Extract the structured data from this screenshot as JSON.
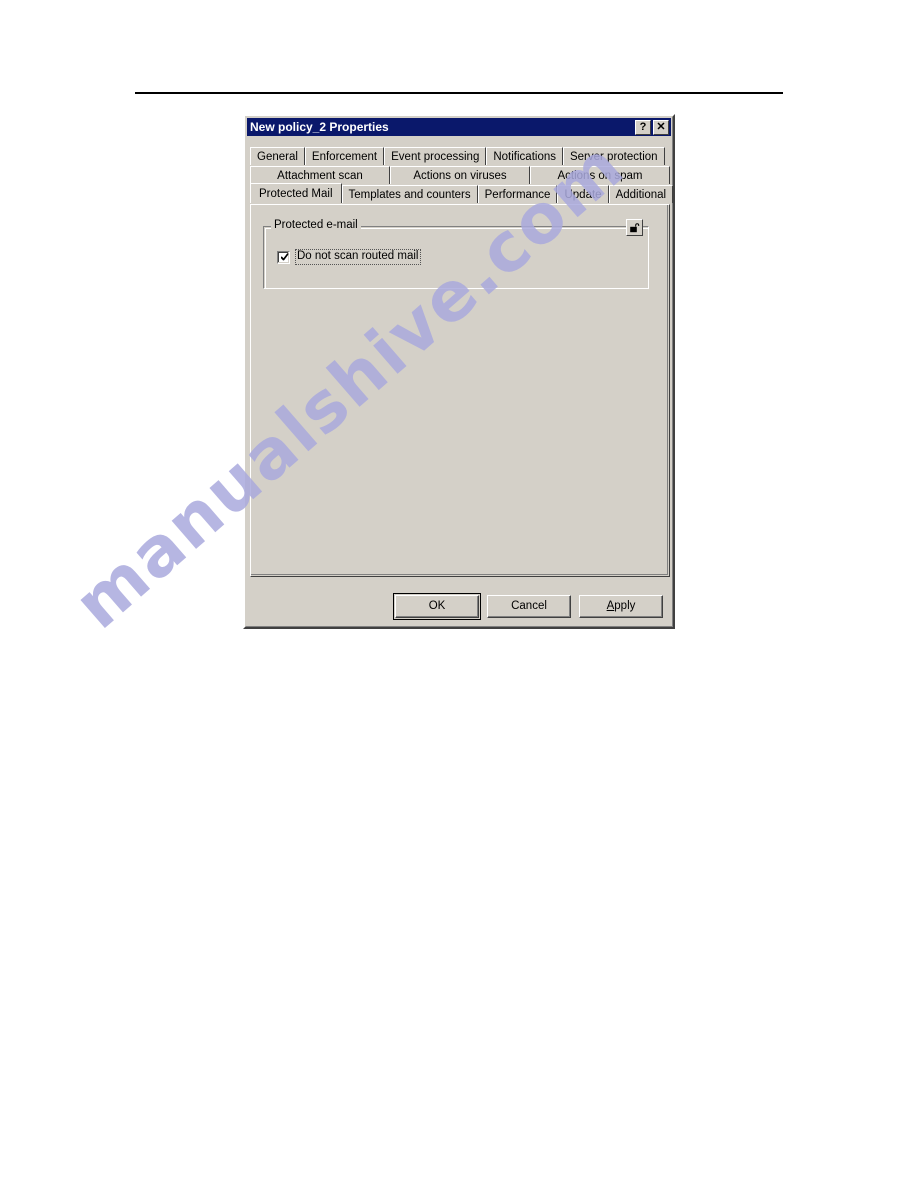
{
  "page": {
    "background_color": "#ffffff",
    "rule_color": "#000000"
  },
  "watermark": {
    "text": "manualshive.com",
    "color": "#aaaadd"
  },
  "dialog": {
    "title": "New policy_2 Properties",
    "title_bar_color": "#0a186b",
    "face_color": "#d4d0c8",
    "title_buttons": [
      {
        "name": "help-button",
        "glyph": "?"
      },
      {
        "name": "close-button",
        "glyph": "✕"
      }
    ],
    "tabs": {
      "rows": [
        {
          "items": [
            {
              "label": "General",
              "active": false
            },
            {
              "label": "Enforcement",
              "active": false
            },
            {
              "label": "Event processing",
              "active": false
            },
            {
              "label": "Notifications",
              "active": false
            },
            {
              "label": "Server protection",
              "active": false
            }
          ]
        },
        {
          "items": [
            {
              "label": "Attachment scan",
              "active": false
            },
            {
              "label": "Actions on viruses",
              "active": false
            },
            {
              "label": "Actions on spam",
              "active": false
            }
          ]
        },
        {
          "items": [
            {
              "label": "Protected Mail",
              "active": true
            },
            {
              "label": "Templates and counters",
              "active": false
            },
            {
              "label": "Performance",
              "active": false
            },
            {
              "label": "Update",
              "active": false
            },
            {
              "label": "Additional",
              "active": false
            }
          ]
        }
      ],
      "selected": "Protected Mail"
    },
    "page_content": {
      "group": {
        "title": "Protected e-mail",
        "lock_icon": "open-padlock-icon",
        "checkbox": {
          "label": "Do not scan routed mail",
          "checked": true,
          "focused": true
        }
      }
    },
    "buttons": [
      {
        "label": "OK",
        "default": true,
        "accel": ""
      },
      {
        "label": "Cancel",
        "default": false,
        "accel": ""
      },
      {
        "label": "Apply",
        "default": false,
        "accel": "A"
      }
    ]
  }
}
